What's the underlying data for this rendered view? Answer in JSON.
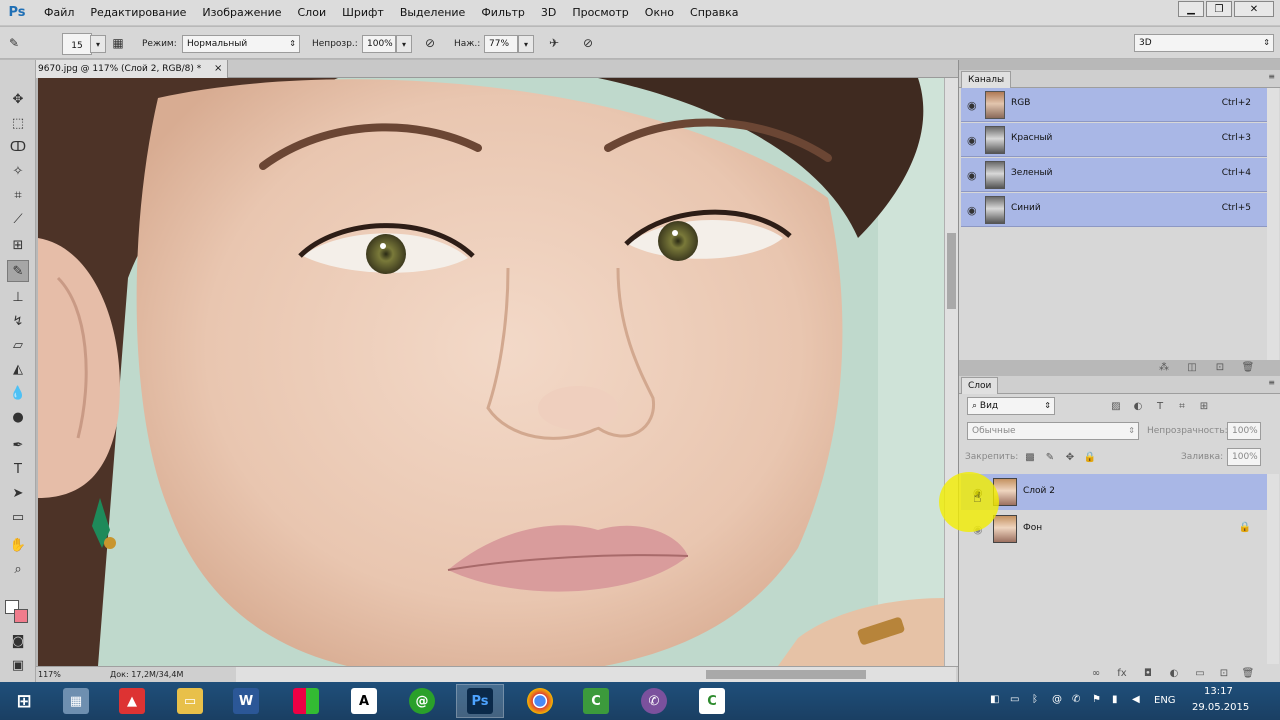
{
  "menubar": {
    "logo": "Ps",
    "items": [
      "Файл",
      "Редактирование",
      "Изображение",
      "Слои",
      "Шрифт",
      "Выделение",
      "Фильтр",
      "3D",
      "Просмотр",
      "Окно",
      "Справка"
    ],
    "window_buttons": {
      "minimize": "▁",
      "restore": "❐",
      "close": "✕"
    }
  },
  "options": {
    "brush_size": "15",
    "mode_label": "Режим:",
    "mode_value": "Нормальный",
    "opacity_label": "Непрозр.:",
    "opacity_value": "100%",
    "flow_label": "Наж.:",
    "flow_value": "77%",
    "workspace": "3D"
  },
  "document": {
    "tab_title": "9670.jpg @ 117% (Слой 2, RGB/8) *",
    "close": "×",
    "zoom": "117%",
    "doc_info": "Док: 17,2M/34,4M"
  },
  "channels": {
    "title": "Каналы",
    "rows": [
      {
        "name": "RGB",
        "shortcut": "Ctrl+2"
      },
      {
        "name": "Красный",
        "shortcut": "Ctrl+3"
      },
      {
        "name": "Зеленый",
        "shortcut": "Ctrl+4"
      },
      {
        "name": "Синий",
        "shortcut": "Ctrl+5"
      }
    ]
  },
  "layers": {
    "title": "Слои",
    "filter_label": "Вид",
    "blend_mode": "Обычные",
    "opacity_label": "Непрозрачность:",
    "opacity_value": "100%",
    "lock_label": "Закрепить:",
    "fill_label": "Заливка:",
    "fill_value": "100%",
    "rows": [
      {
        "name": "Слой 2",
        "selected": true
      },
      {
        "name": "Фон",
        "locked": true
      }
    ]
  },
  "taskbar": {
    "language": "ENG",
    "time": "13:17",
    "date": "29.05.2015",
    "apps": [
      "start",
      "calculator",
      "pdf",
      "explorer",
      "word",
      "tiles",
      "font",
      "mail-agent",
      "photoshop",
      "chrome",
      "camtasia",
      "viber",
      "camtasia-recorder"
    ]
  },
  "colors": {
    "selection": "#a9b7e6",
    "taskbar": "#1f4f7a",
    "ps_blue": "#1f6fb5",
    "cursor_highlight": "#f2ee00"
  }
}
